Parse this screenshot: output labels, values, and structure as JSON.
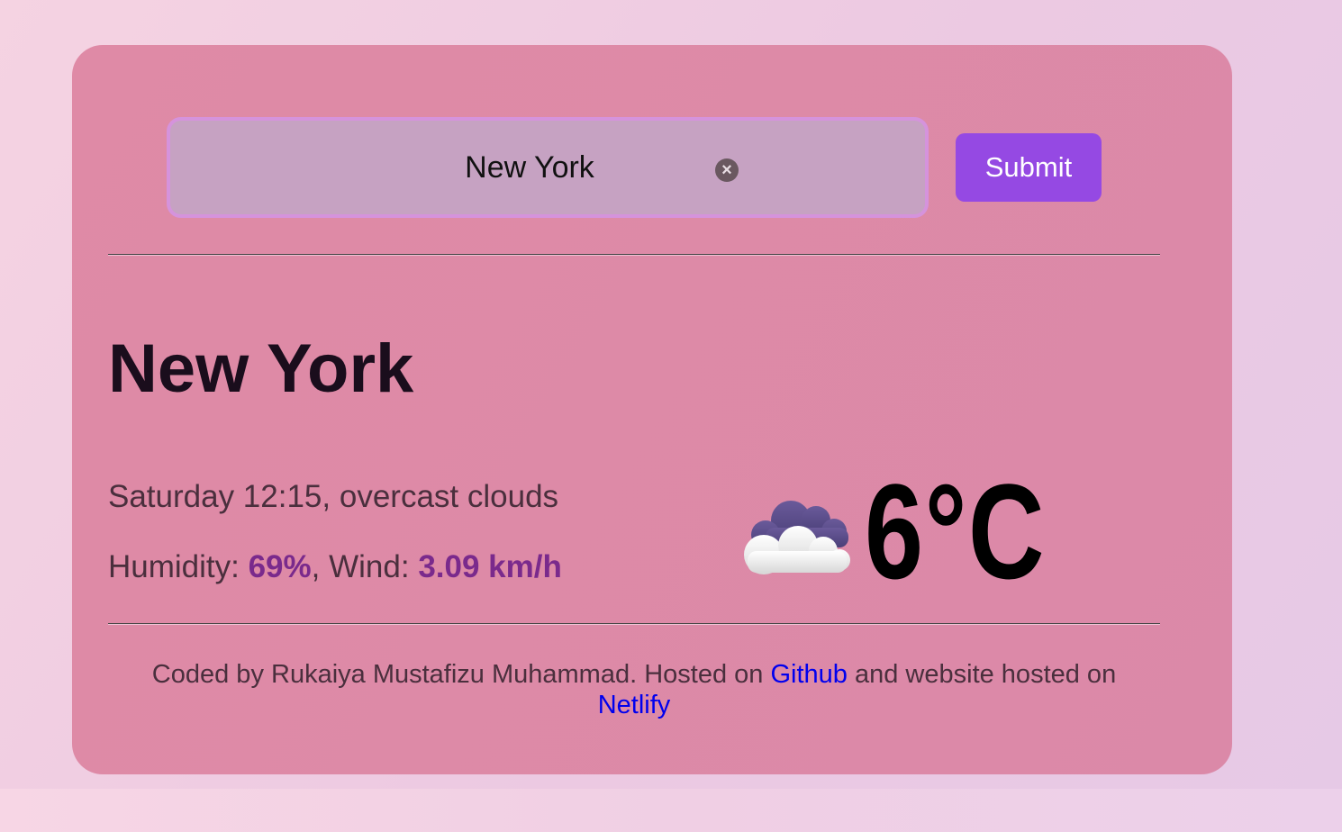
{
  "search": {
    "value": "New York",
    "submit_label": "Submit"
  },
  "weather": {
    "city": "New York",
    "day_time": "Saturday 12:15",
    "description": "overcast clouds",
    "humidity_label": "Humidity: ",
    "humidity_value": "69%",
    "wind_label": "Wind: ",
    "wind_value": "3.09 km/h",
    "temperature": "6°C",
    "icon": "cloud-icon"
  },
  "footer": {
    "text_before": "Coded by Rukaiya Mustafizu Muhammad. Hosted on ",
    "github_label": "Github",
    "text_middle": " and website hosted on ",
    "netlify_label": "Netlify"
  },
  "colors": {
    "card": "#dd89a7",
    "accent": "#9549e3",
    "highlight": "#7a2a8c",
    "link": "#0000ee"
  }
}
